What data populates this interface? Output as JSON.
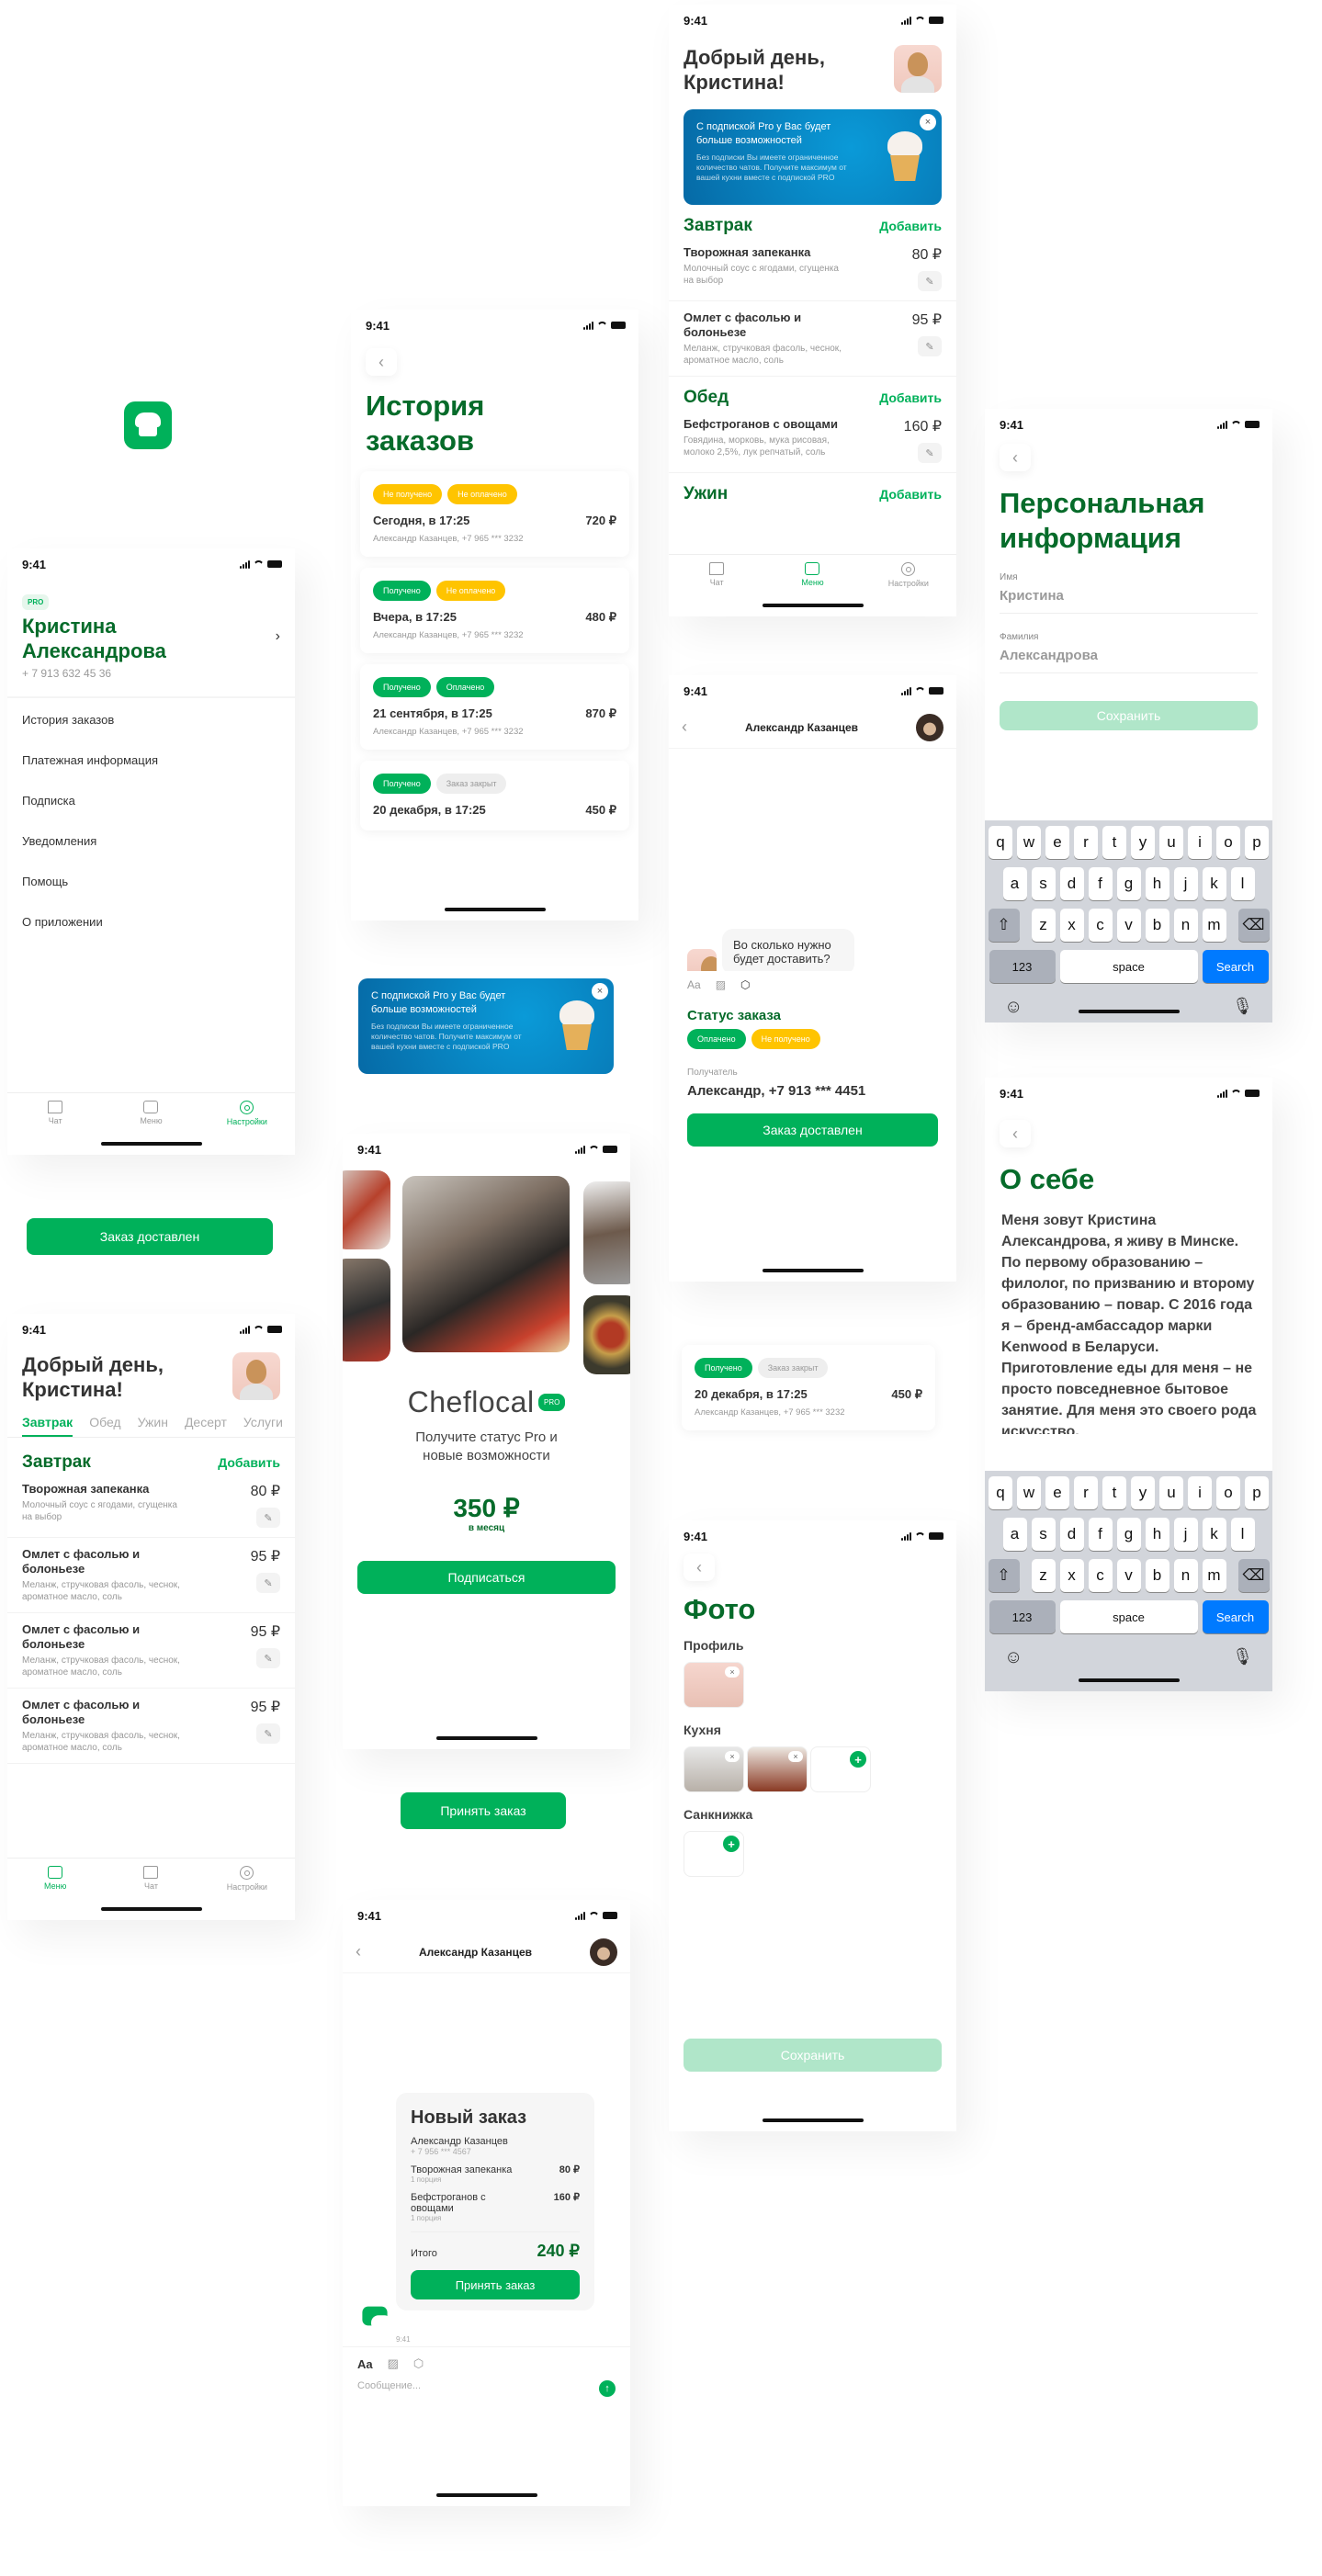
{
  "status_time": "9:41",
  "colors": {
    "brand_green": "#00b15a",
    "dark_green": "#066b2a",
    "yellow": "#ffc400",
    "blue": "#007aff"
  },
  "tabbar": {
    "chat": "Чат",
    "menu": "Меню",
    "settings": "Настройки"
  },
  "settings": {
    "badge": "PRO",
    "name": "Кристина Александрова",
    "phone": "+ 7 913 632 45 36",
    "items": [
      "История заказов",
      "Платежная информация",
      "Подписка",
      "Уведомления",
      "Помощь",
      "О приложении"
    ]
  },
  "standalone": {
    "delivered_button": "Заказ доставлен",
    "accept_button": "Принять заказ"
  },
  "history": {
    "title": "История заказов",
    "orders": [
      {
        "tags": [
          "Не получено",
          "Не оплачено"
        ],
        "date": "Сегодня, в 17:25",
        "price": "720 ₽",
        "client": "Александр Казанцев, +7 965 *** 3232"
      },
      {
        "tags": [
          "Получено",
          "Не оплачено"
        ],
        "date": "Вчера, в 17:25",
        "price": "480 ₽",
        "client": "Александр Казанцев, +7 965 *** 3232"
      },
      {
        "tags": [
          "Получено",
          "Оплачено"
        ],
        "date": "21 сентября, в 17:25",
        "price": "870 ₽",
        "client": "Александр Казанцев, +7 965 *** 3232"
      },
      {
        "tags": [
          "Получено",
          "Заказ закрыт"
        ],
        "date": "20 декабря, в 17:25",
        "price": "450 ₽",
        "client": "Александр Казанцев, +7 965 *** 3232"
      }
    ]
  },
  "promo": {
    "title": "С подпиской Pro у Вас будет больше возможностей",
    "text": "Без подписки Вы имеете ограниченное количество чатов. Получите максимум от вашей кухни вместе с подпиской PRO"
  },
  "home": {
    "greeting": "Добрый день, Кристина!",
    "tabs": [
      "Завтрак",
      "Обед",
      "Ужин",
      "Десерт",
      "Услуги"
    ],
    "add": "Добавить",
    "sections": {
      "breakfast": "Завтрак",
      "lunch": "Обед",
      "dinner": "Ужин"
    },
    "dishes": [
      {
        "name": "Творожная запеканка",
        "desc": "Молочный соус с ягодами, сгущенка на выбор",
        "price": "80 ₽"
      },
      {
        "name": "Омлет с фасолью и болоньезе",
        "desc": "Меланж, стручковая фасоль, чеснок, ароматное масло, соль",
        "price": "95 ₽"
      },
      {
        "name": "Бефстроганов с овощами",
        "desc": "Говядина, морковь, мука рисовая, молоко 2,5%, лук репчатый, соль",
        "price": "160 ₽"
      }
    ]
  },
  "chat1": {
    "contact": "Александр Казанцев",
    "message": "Во сколько нужно будет доставить?",
    "tools": [
      "Aa"
    ],
    "status_title": "Статус заказа",
    "tags": [
      "Оплачено",
      "Не получено"
    ],
    "recipient_label": "Получатель",
    "recipient": "Александр, +7 913 *** 4451",
    "button": "Заказ доставлен"
  },
  "personal": {
    "title": "Персональная информация",
    "first_label": "Имя",
    "first_value": "Кристина",
    "last_label": "Фамилия",
    "last_value": "Александрова",
    "save": "Сохранить"
  },
  "keyboard": {
    "row1": [
      "q",
      "w",
      "e",
      "r",
      "t",
      "y",
      "u",
      "i",
      "o",
      "p"
    ],
    "row2": [
      "a",
      "s",
      "d",
      "f",
      "g",
      "h",
      "j",
      "k",
      "l"
    ],
    "row3": [
      "z",
      "x",
      "c",
      "v",
      "b",
      "n",
      "m"
    ],
    "n123": "123",
    "space": "space",
    "search": "Search"
  },
  "pro": {
    "brand": "Cheflocal",
    "badge": "PRO",
    "subtitle": "Получите статус Pro и новые возможности",
    "price": "350 ₽",
    "period": "в месяц",
    "button": "Подписаться"
  },
  "about": {
    "title": "О себе",
    "text": "Меня зовут Кристина Александрова, я живу в Минске. По первому образованию – филолог, по призванию и второму образованию – повар. С 2016 года я – бренд-амбассадор марки Kenwood в Беларуси. Приготовление еды для меня – не просто повседневное бытовое занятие. Для меня это своего рода искусство."
  },
  "photos": {
    "title": "Фото",
    "profile": "Профиль",
    "kitchen": "Кухня",
    "sanbook": "Санкнижка",
    "save": "Сохранить"
  },
  "chat2": {
    "contact": "Александр Казанцев",
    "order_title": "Новый заказ",
    "client": "Александр Казанцев",
    "client_phone": "+ 7 956 *** 4567",
    "items": [
      {
        "name": "Творожная запеканка",
        "qty": "1 порция",
        "price": "80 ₽"
      },
      {
        "name": "Бефстроганов с овощами",
        "qty": "1 порция",
        "price": "160 ₽"
      }
    ],
    "total_label": "Итого",
    "total": "240 ₽",
    "button": "Принять заказ",
    "time": "9:41",
    "font_tool": "Aa",
    "placeholder": "Сообщение..."
  }
}
